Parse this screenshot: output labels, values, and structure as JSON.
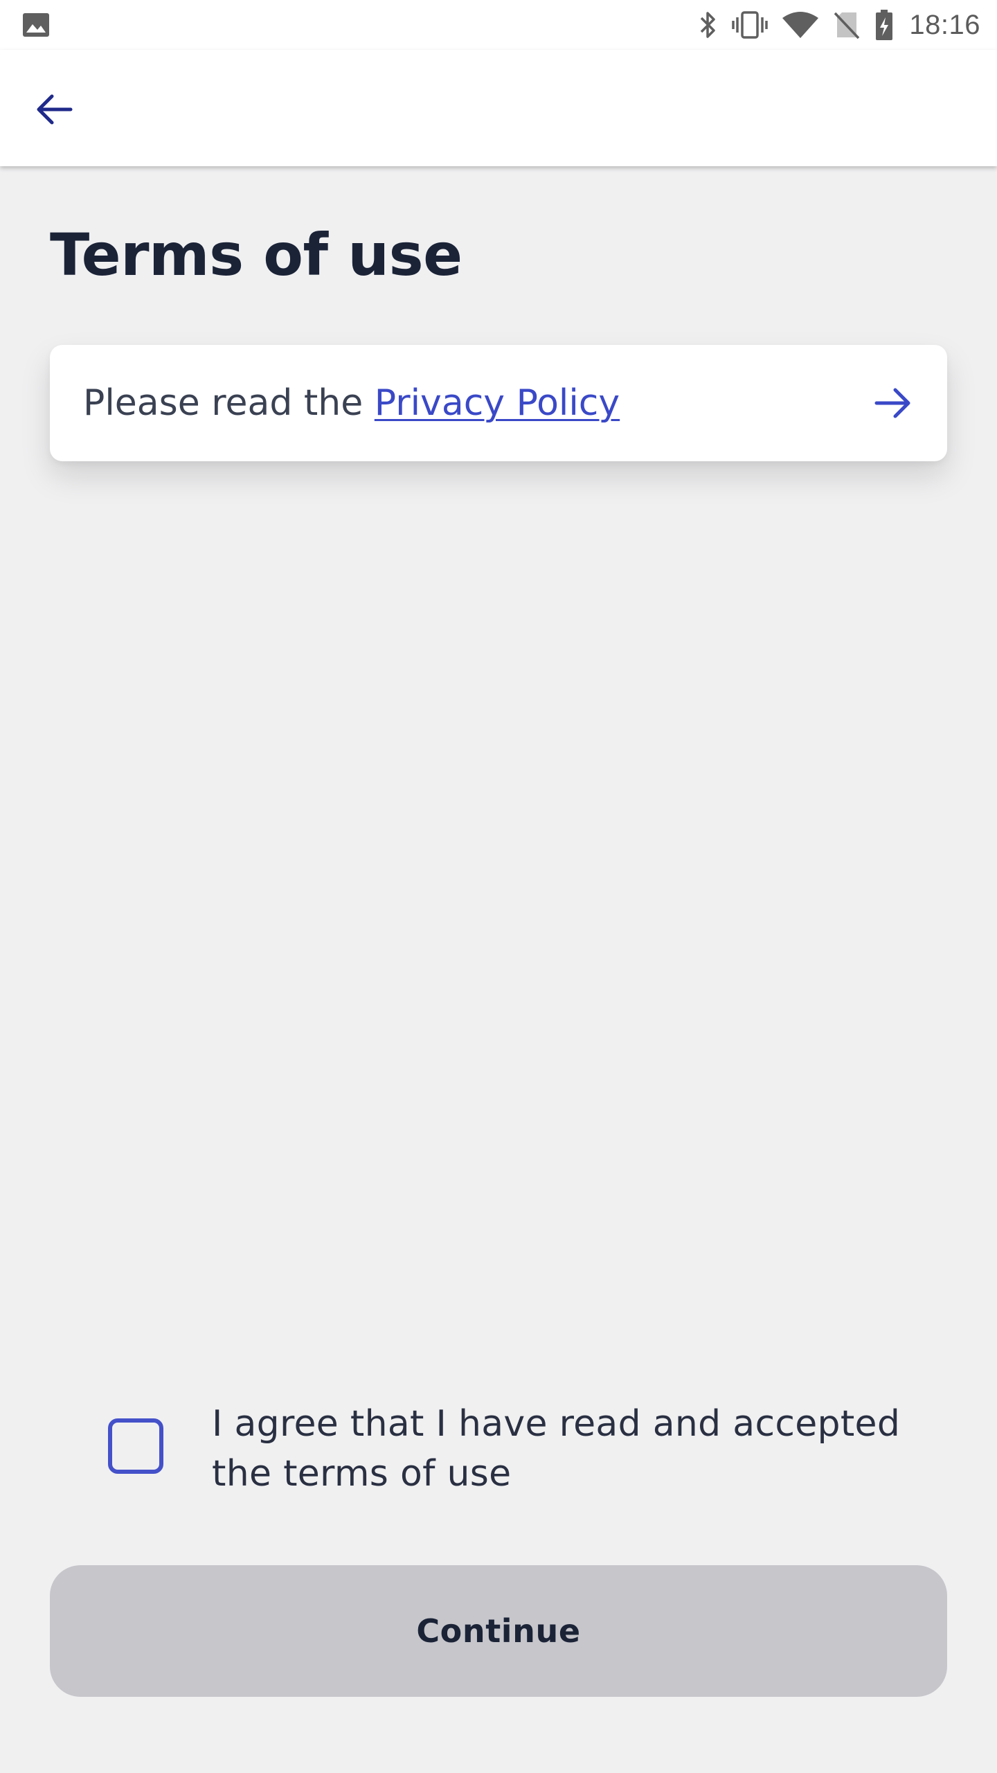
{
  "status_bar": {
    "time": "18:16",
    "icons": [
      "image-icon",
      "bluetooth-icon",
      "vibrate-icon",
      "wifi-icon",
      "no-sim-icon",
      "battery-charging-icon"
    ]
  },
  "app_bar": {
    "back_icon": "arrow-left-icon"
  },
  "page": {
    "title": "Terms of use"
  },
  "privacy_card": {
    "prefix": "Please read the ",
    "link_text": "Privacy Policy",
    "arrow_icon": "arrow-right-icon"
  },
  "agreement": {
    "checked": false,
    "label": "I agree that I have read and accepted the terms of use"
  },
  "continue_button": {
    "label": "Continue",
    "enabled": false
  },
  "colors": {
    "accent": "#3a49c7",
    "background": "#f0f0f1",
    "title": "#1b2337",
    "button_disabled": "#c6c6cb"
  }
}
